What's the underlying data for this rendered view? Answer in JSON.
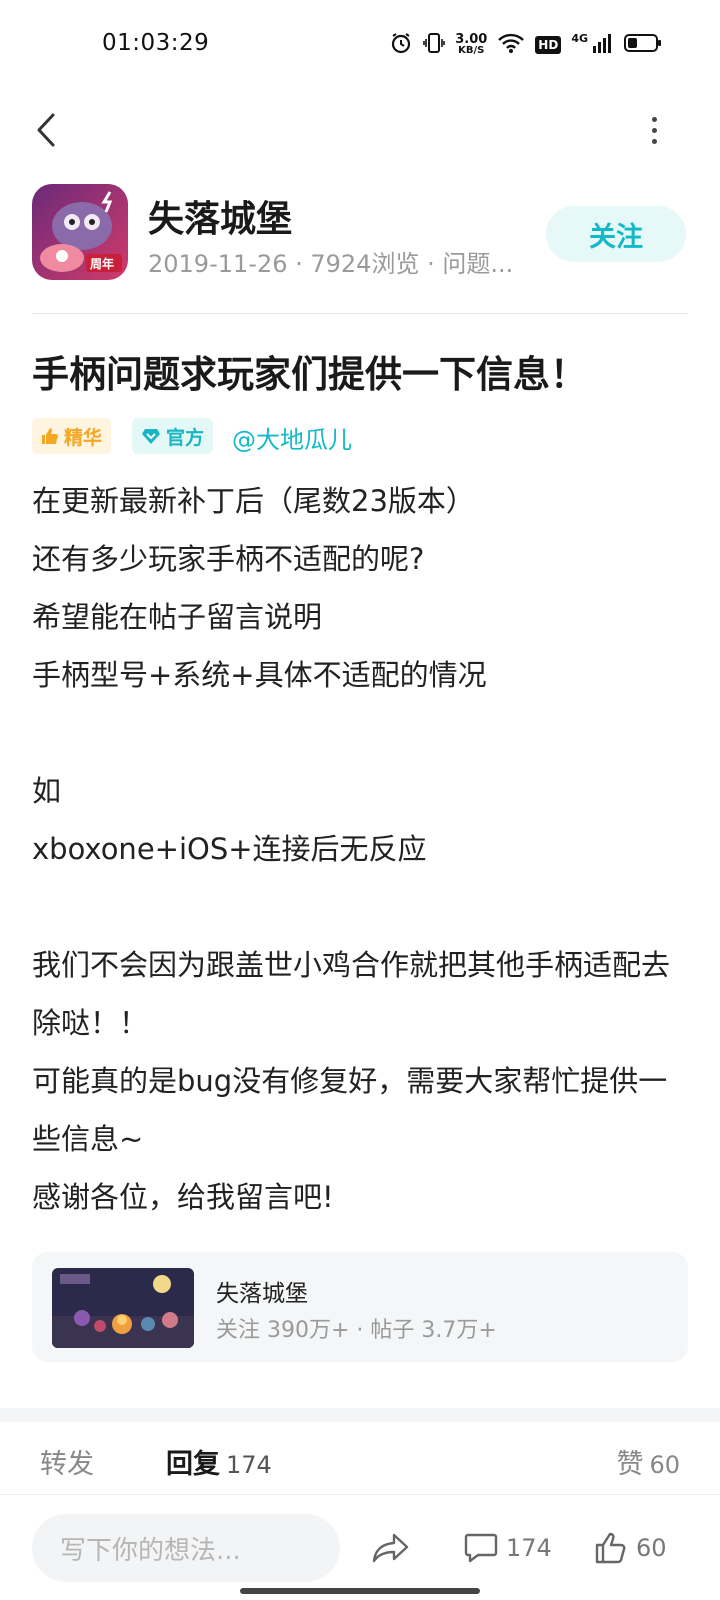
{
  "status_bar": {
    "time": "01:03:29",
    "net_speed_value": "3.00",
    "net_speed_unit": "KB/S",
    "hd_label": "HD",
    "signal_label": "4G"
  },
  "nav": {
    "back_icon": "chevron-left-icon",
    "more_icon": "more-vertical-icon"
  },
  "header": {
    "game_name": "失落城堡",
    "meta": "2019-11-26 · 7924浏览 · 问题...",
    "icon_badge": "周年",
    "follow_label": "关注"
  },
  "post": {
    "title": "手柄问题求玩家们提供一下信息！",
    "tags": [
      {
        "label": "精华",
        "icon": "thumbs-up-icon",
        "color": "#f5a623"
      },
      {
        "label": "官方",
        "icon": "verified-heart-icon",
        "color": "#18b6c2"
      }
    ],
    "author": "@大地瓜儿",
    "body": "在更新最新补丁后（尾数23版本）\n还有多少玩家手柄不适配的呢?\n希望能在帖子留言说明\n手柄型号+系统+具体不适配的情况\n\n如\nxboxone+iOS+连接后无反应\n\n我们不会因为跟盖世小鸡合作就把其他手柄适配去除哒！！\n可能真的是bug没有修复好，需要大家帮忙提供一些信息~\n感谢各位，给我留言吧!"
  },
  "game_card": {
    "name": "失落城堡",
    "stats": "关注 390万+ · 帖子 3.7万+"
  },
  "tabs": {
    "forward": "转发",
    "reply": "回复",
    "reply_count": "174",
    "like": "赞",
    "like_count": "60"
  },
  "bottom_bar": {
    "placeholder": "写下你的想法...",
    "comment_count": "174",
    "like_count": "60"
  },
  "colors": {
    "accent": "#14b9c8",
    "accent_bg": "#e6f8f8",
    "essence": "#f5a623"
  }
}
